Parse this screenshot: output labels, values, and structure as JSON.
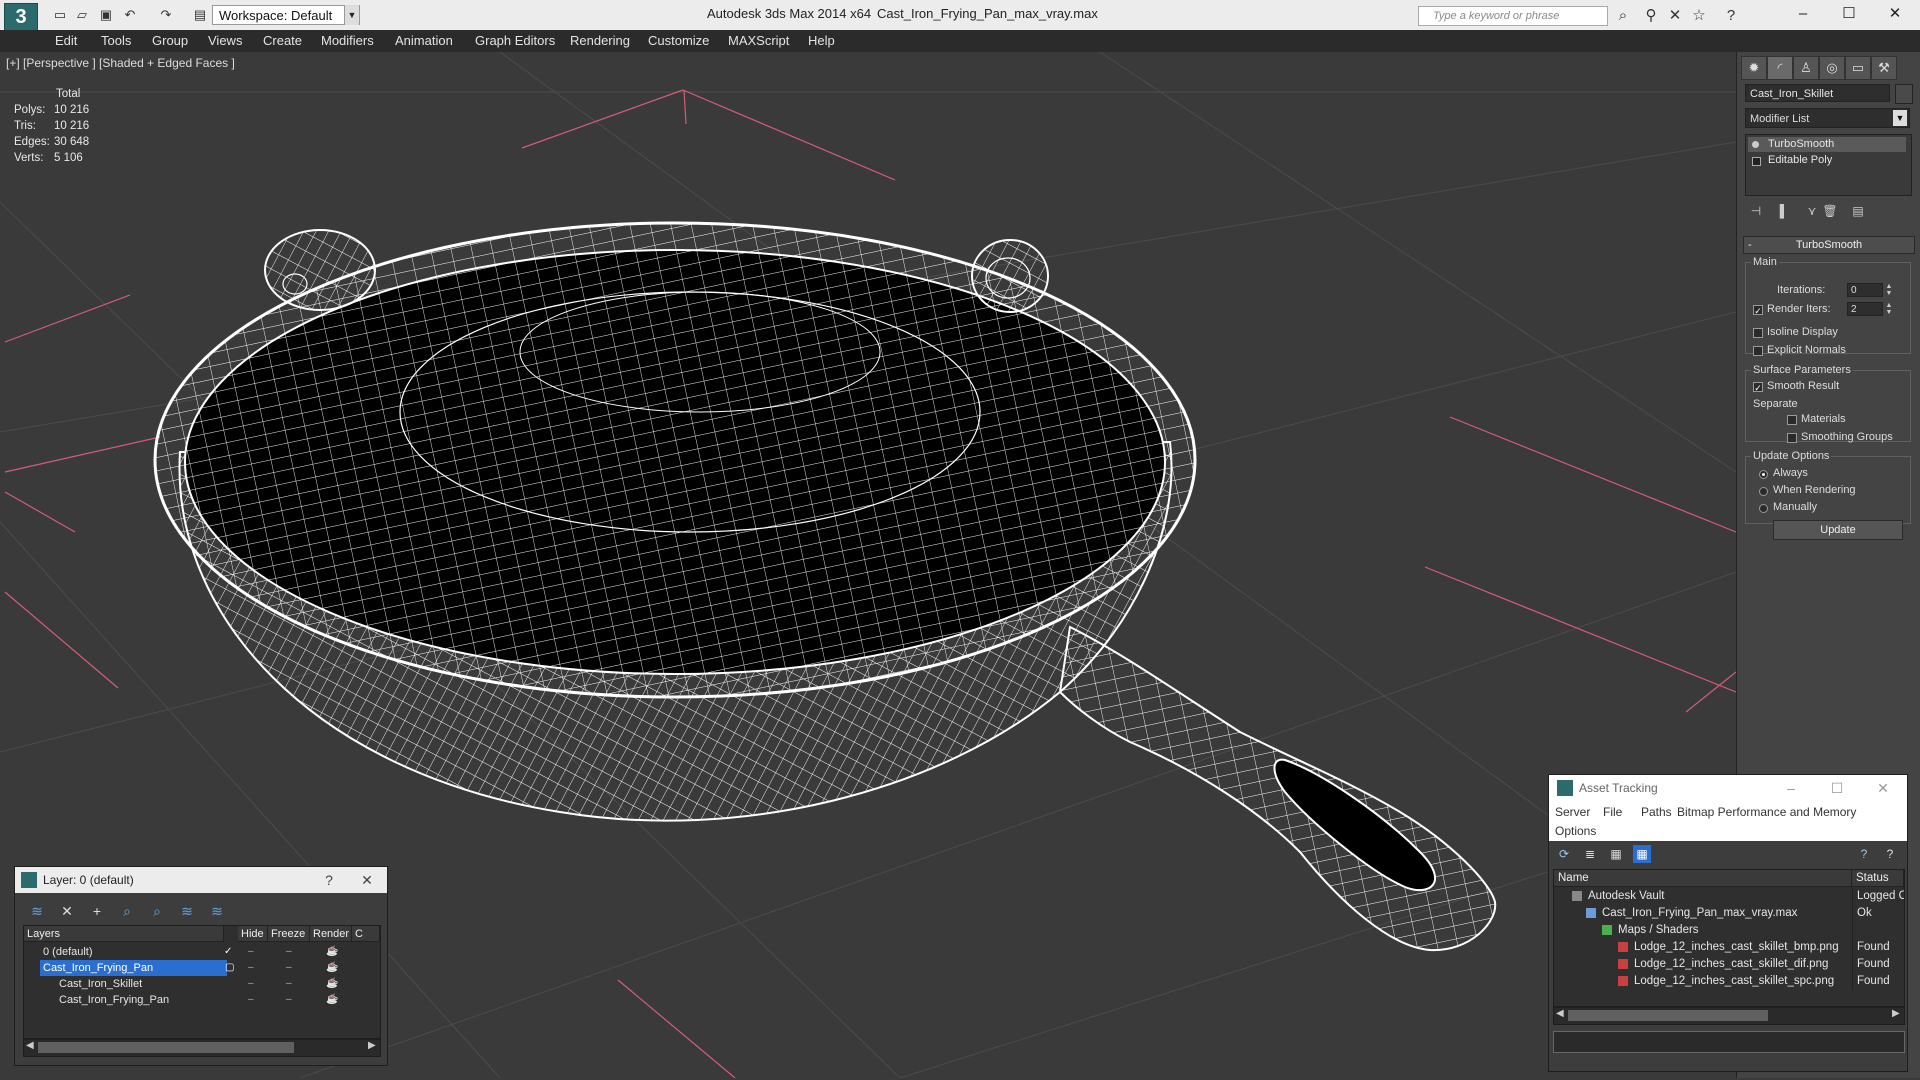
{
  "titlebar": {
    "workspace": "Workspace: Default",
    "app_title": "Autodesk 3ds Max  2014 x64",
    "file_title": "Cast_Iron_Frying_Pan_max_vray.max",
    "search_placeholder": "Type a keyword or phrase"
  },
  "menu": [
    "Edit",
    "Tools",
    "Group",
    "Views",
    "Create",
    "Modifiers",
    "Animation",
    "Graph Editors",
    "Rendering",
    "Customize",
    "MAXScript",
    "Help"
  ],
  "viewport": {
    "label": "[+] [Perspective ] [Shaded + Edged Faces ]",
    "stats_header": "Total",
    "stats": [
      {
        "name": "Polys:",
        "value": "10 216"
      },
      {
        "name": "Tris:",
        "value": "10 216"
      },
      {
        "name": "Edges:",
        "value": "30 648"
      },
      {
        "name": "Verts:",
        "value": "5 106"
      }
    ]
  },
  "command_panel": {
    "object_name": "Cast_Iron_Skillet",
    "modifier_list": "Modifier List",
    "stack": [
      "TurboSmooth",
      "Editable Poly"
    ],
    "rollout_title": "TurboSmooth",
    "main_label": "Main",
    "iterations_label": "Iterations:",
    "iterations_value": "0",
    "render_iters_label": "Render Iters:",
    "render_iters_value": "2",
    "isoline_display": "Isoline Display",
    "explicit_normals": "Explicit Normals",
    "surface_parameters": "Surface Parameters",
    "smooth_result": "Smooth Result",
    "separate": "Separate",
    "materials": "Materials",
    "smoothing_groups": "Smoothing Groups",
    "update_options": "Update Options",
    "always": "Always",
    "when_rendering": "When Rendering",
    "manually": "Manually",
    "update_button": "Update"
  },
  "layer_dialog": {
    "title": "Layer: 0 (default)",
    "help": "?",
    "columns": [
      "Layers",
      "Hide",
      "Freeze",
      "Render"
    ],
    "rows": [
      {
        "name": "0 (default)",
        "indent": 0
      },
      {
        "name": "Cast_Iron_Frying_Pan",
        "indent": 0
      },
      {
        "name": "Cast_Iron_Skillet",
        "indent": 1
      },
      {
        "name": "Cast_Iron_Frying_Pan",
        "indent": 1
      }
    ]
  },
  "asset_tracking": {
    "title": "Asset Tracking",
    "menu": [
      "Server",
      "File",
      "Paths",
      "Bitmap Performance and Memory",
      "Options"
    ],
    "columns": [
      "Name",
      "Status"
    ],
    "rows": [
      {
        "name": "Autodesk Vault",
        "status": "Logged O"
      },
      {
        "name": "Cast_Iron_Frying_Pan_max_vray.max",
        "status": "Ok"
      },
      {
        "name": "Maps / Shaders",
        "status": ""
      },
      {
        "name": "Lodge_12_inches_cast_skillet_bmp.png",
        "status": "Found"
      },
      {
        "name": "Lodge_12_inches_cast_skillet_dif.png",
        "status": "Found"
      },
      {
        "name": "Lodge_12_inches_cast_skillet_spc.png",
        "status": "Found"
      }
    ]
  },
  "colors": {
    "viewport_bg": "#3a3a3a",
    "wire": "#ffffff",
    "grid": "#4c4c4c",
    "accent_red": "#d45c7a",
    "selection_blue": "#2a6fd0"
  }
}
